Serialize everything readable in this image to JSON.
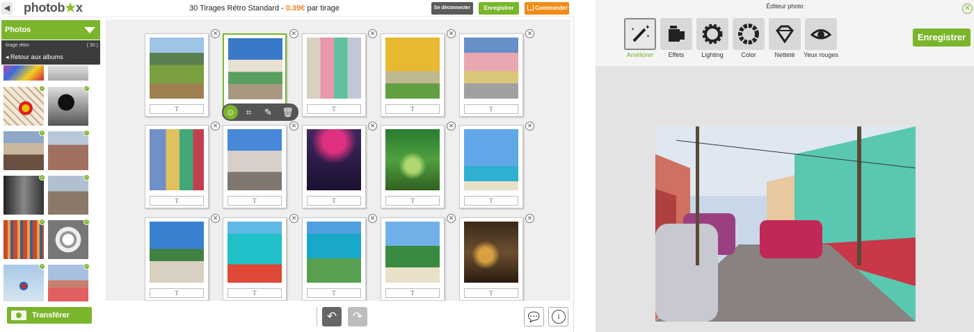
{
  "topbar": {
    "logo_main": "photob",
    "logo_star": "★",
    "logo_end": "x",
    "title_prefix": "30 Tirages Rétro Standard - ",
    "title_price": "0.39€",
    "title_suffix": " par tirage",
    "logout_label": "Se déconnecter",
    "save_label": "Enregistrer",
    "order_label": "Commander"
  },
  "sidebar": {
    "header": "Photos",
    "filter": "tirage rétro",
    "count": "( 30 )",
    "back_label": "Retour aux albums",
    "transfer_label": "Transférer"
  },
  "workspace": {
    "caption_placeholder": "T"
  },
  "editor": {
    "title": "Éditeur photo",
    "save_label": "Enregistrer",
    "tools": [
      {
        "label": "Améliorer",
        "icon": "magic-wand-icon",
        "active": true
      },
      {
        "label": "Effets",
        "icon": "effects-icon",
        "active": false
      },
      {
        "label": "Lighting",
        "icon": "sun-gear-icon",
        "active": false
      },
      {
        "label": "Color",
        "icon": "color-wheel-icon",
        "active": false
      },
      {
        "label": "Netteté",
        "icon": "diamond-icon",
        "active": false
      },
      {
        "label": "Yeux rouges",
        "icon": "eye-icon",
        "active": false
      }
    ]
  },
  "colors": {
    "accent": "#7ab52c",
    "order": "#f28c17",
    "dark": "#5b5b5b"
  }
}
